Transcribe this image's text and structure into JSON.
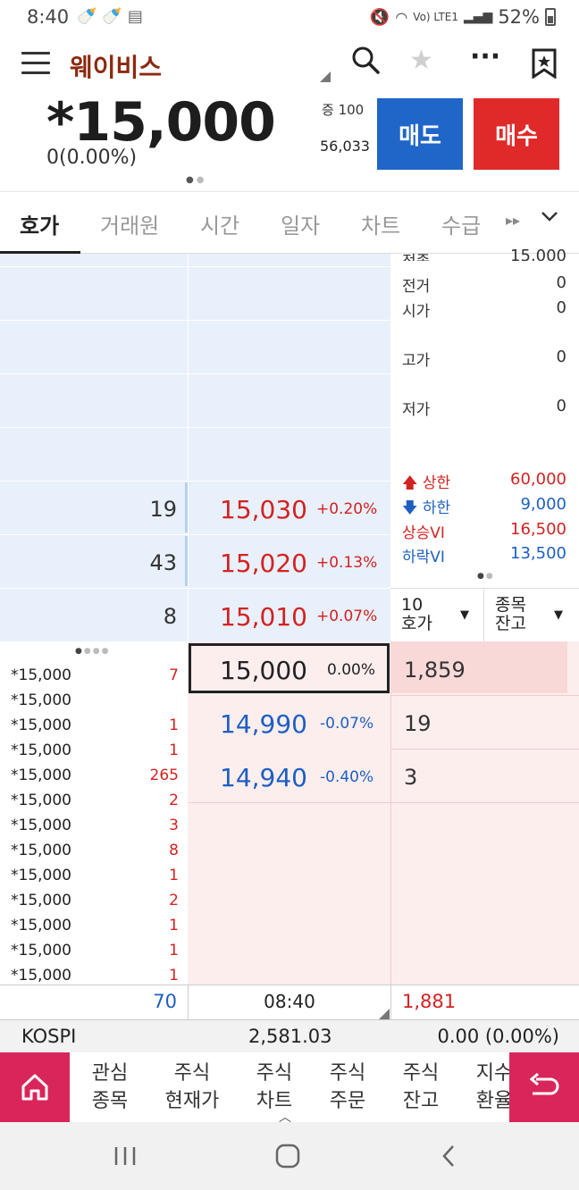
{
  "status_bar": {
    "time": "8:40",
    "network": "Vo) LTE1",
    "battery": "52%"
  },
  "header": {
    "stock_name": "웨이비스",
    "price": "*15,000",
    "change": "0(0.00%)",
    "margin_label": "증 100",
    "volume": "56,033",
    "sell_label": "매도",
    "buy_label": "매수",
    "icons": [
      "menu-icon",
      "search-icon",
      "star-icon",
      "more-icon",
      "bookmark-icon"
    ]
  },
  "tabs": [
    "호가",
    "거래원",
    "시간",
    "일자",
    "차트",
    "수급"
  ],
  "asks": [
    {
      "qty": "19",
      "price": "15,030",
      "pct": "+0.20%"
    },
    {
      "qty": "43",
      "price": "15,020",
      "pct": "+0.13%"
    },
    {
      "qty": "8",
      "price": "15,010",
      "pct": "+0.07%"
    }
  ],
  "current": {
    "price": "15,000",
    "pct": "0.00%",
    "qty": "1,859"
  },
  "bids": [
    {
      "price": "14,990",
      "pct": "-0.07%",
      "qty": "19"
    },
    {
      "price": "14,940",
      "pct": "-0.40%",
      "qty": "3"
    }
  ],
  "info": {
    "rows": [
      {
        "label": "전종",
        "value": "15,000"
      },
      {
        "label": "전거",
        "value": "0"
      },
      {
        "label": "시가",
        "value": "0"
      },
      {
        "label": "고가",
        "value": "0"
      },
      {
        "label": "저가",
        "value": "0"
      }
    ],
    "limit_up_label": "상한",
    "limit_up_value": "60,000",
    "limit_down_label": "하한",
    "limit_down_value": "9,000",
    "vi_up_label": "상승VI",
    "vi_up_value": "16,500",
    "vi_down_label": "하락VI",
    "vi_down_value": "13,500",
    "hoga_select_line1": "10",
    "hoga_select_line2": "호가",
    "balance_select_line1": "종목",
    "balance_select_line2": "잔고"
  },
  "trades": [
    {
      "price": "*15,000",
      "vol": "7"
    },
    {
      "price": "*15,000",
      "vol": ""
    },
    {
      "price": "*15,000",
      "vol": "1"
    },
    {
      "price": "*15,000",
      "vol": "1"
    },
    {
      "price": "*15,000",
      "vol": "265"
    },
    {
      "price": "*15,000",
      "vol": "2"
    },
    {
      "price": "*15,000",
      "vol": "3"
    },
    {
      "price": "*15,000",
      "vol": "8"
    },
    {
      "price": "*15,000",
      "vol": "1"
    },
    {
      "price": "*15,000",
      "vol": "2"
    },
    {
      "price": "*15,000",
      "vol": "1"
    },
    {
      "price": "*15,000",
      "vol": "1"
    },
    {
      "price": "*15,000",
      "vol": "1"
    }
  ],
  "summary": {
    "total_ask": "70",
    "time": "08:40",
    "total_bid": "1,881"
  },
  "kospi": {
    "label": "KOSPI",
    "value": "2,581.03",
    "change": "0.00 (0.00%)"
  },
  "bottom_nav": [
    {
      "line1": "관심",
      "line2": "종목"
    },
    {
      "line1": "주식",
      "line2": "현재가"
    },
    {
      "line1": "주식",
      "line2": "차트"
    },
    {
      "line1": "주식",
      "line2": "주문"
    },
    {
      "line1": "주식",
      "line2": "잔고"
    },
    {
      "line1": "지수",
      "line2": "환율"
    }
  ],
  "colors": {
    "sell": "#1f66c8",
    "buy": "#e02929",
    "nav_accent": "#d9265a",
    "stock_name": "#8b2a10"
  }
}
